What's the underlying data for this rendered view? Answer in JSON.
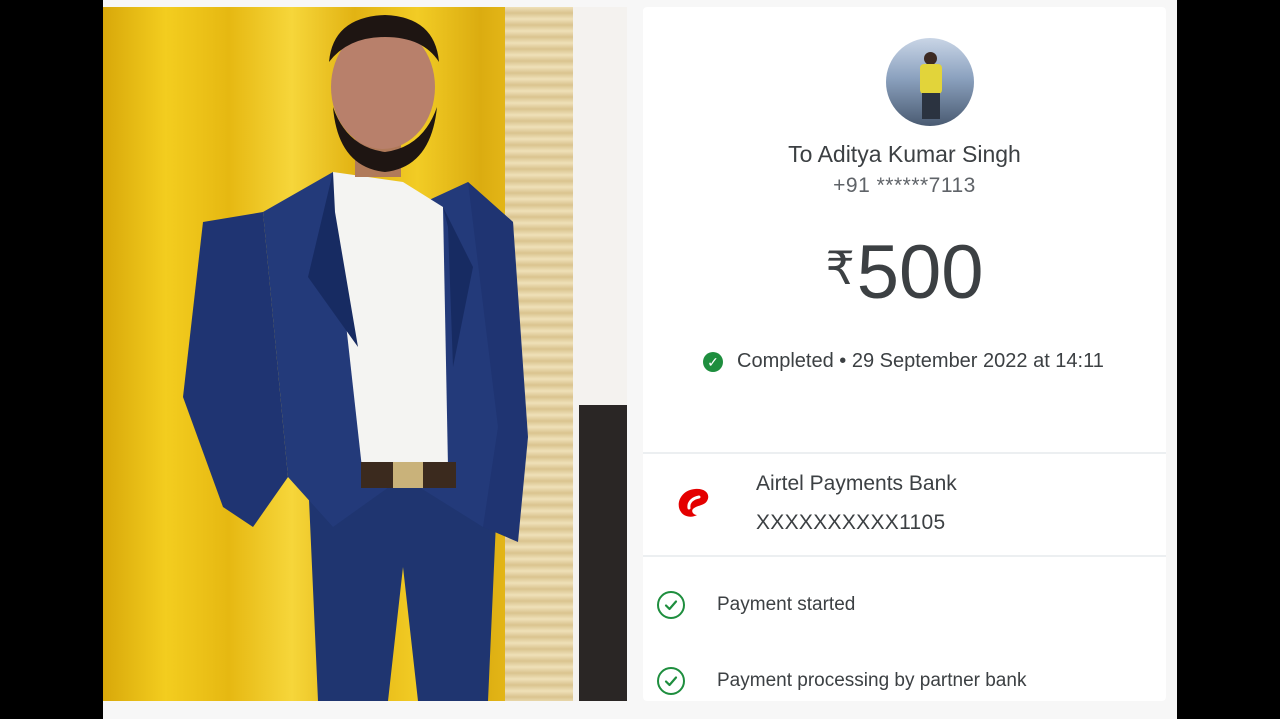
{
  "payment": {
    "recipient_label": "To Aditya Kumar Singh",
    "phone_masked": "+91 ******7113",
    "currency_symbol": "₹",
    "amount": "500",
    "status_text": "Completed • 29 September 2022 at 14:11",
    "bank": {
      "name": "Airtel Payments Bank",
      "account_masked": "XXXXXXXXXX1105"
    },
    "steps": [
      {
        "label": "Payment started"
      },
      {
        "label": "Payment processing by partner bank"
      }
    ]
  },
  "icons": {
    "status_icon": "check-circle-filled",
    "bank_icon": "airtel-logo",
    "step_icon": "check-circle-outline"
  },
  "colors": {
    "success": "#1e8e3e",
    "bank_brand": "#e40000",
    "text_primary": "#3c4043",
    "text_secondary": "#5f6368",
    "photo_background": "#f3cd1f",
    "suit": "#243a78"
  }
}
